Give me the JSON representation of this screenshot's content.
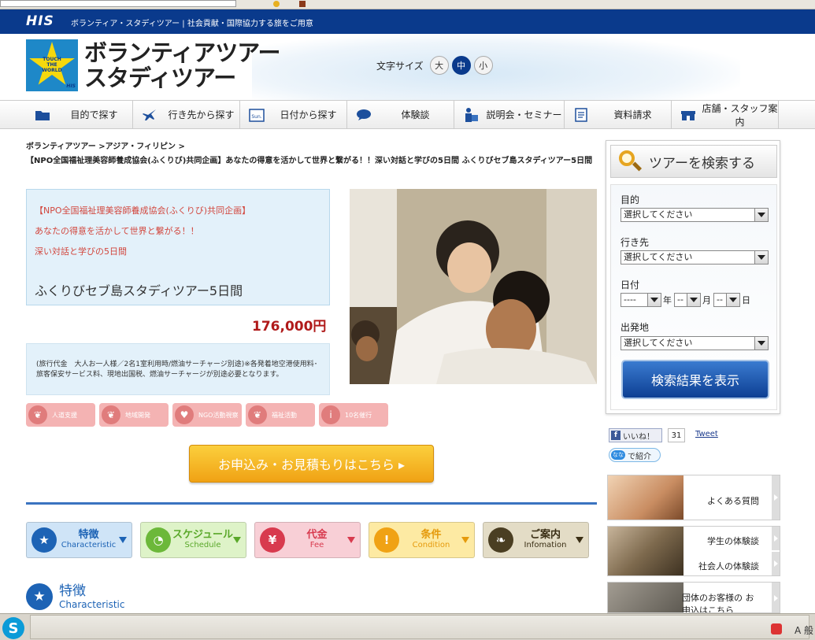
{
  "site": {
    "logo": "HIS",
    "tagline": "ボランティア・スタディツアー | 社会貢献・国際協力する旅をご用意",
    "brand_line1": "ボランティアツアー",
    "brand_line2": "スタディツアー",
    "logo_badge_lines": [
      "TOUCH",
      "THE",
      "WORLD"
    ],
    "logo_badge_sub": "HIS"
  },
  "font_size": {
    "label": "文字サイズ",
    "options": [
      "大",
      "中",
      "小"
    ],
    "selected": "中"
  },
  "nav": {
    "items": [
      {
        "label": "目的で探す",
        "icon": "folder-icon"
      },
      {
        "label": "行き先から探す",
        "icon": "airplane-icon"
      },
      {
        "label": "日付から探す",
        "icon": "calendar-icon",
        "icon_text": "Sun."
      },
      {
        "label": "体験談",
        "icon": "speech-bubble-icon"
      },
      {
        "label": "説明会・セミナー",
        "icon": "presenter-icon"
      },
      {
        "label": "資料請求",
        "icon": "document-icon"
      },
      {
        "label": "店舗・スタッフ案内",
        "icon": "shop-icon"
      }
    ]
  },
  "breadcrumb": {
    "path": "ボランティアツアー >アジア・フィリピン >",
    "current": "【NPO全国福祉理美容師養成協会(ふくりび)共同企画】あなたの得意を活かして世界と繋がる！！深い対話と学びの5日間 ふくりびセブ島スタディツアー5日間"
  },
  "tour": {
    "headline1": "【NPO全国福祉理美容師養成協会(ふくりび)共同企画】",
    "headline2": "あなたの得意を活かして世界と繋がる！！",
    "headline3": "深い対話と学びの5日間",
    "name": "ふくりびセブ島スタディツアー5日間",
    "price": "176,000円",
    "price_note": "(旅行代金　大人お一人様／2名1室利用時/燃油サーチャージ別途)※各発着地空港使用料･旅客保安サービス料、現地出国税、燃油サーチャージが別途必要となります。",
    "tags": [
      {
        "label": "人道支援",
        "icon": "leaf-icon"
      },
      {
        "label": "地域開発",
        "icon": "leaf-icon"
      },
      {
        "label": "NGO活動視察",
        "icon": "heart-icon"
      },
      {
        "label": "福祉活動",
        "icon": "leaf-icon"
      },
      {
        "label": "10名催行",
        "icon": "person-icon"
      }
    ],
    "apply_label": "お申込み・お見積もりはこちら ▸"
  },
  "section_tabs": [
    {
      "jp": "特徴",
      "en": "Characteristic",
      "icon": "star-icon",
      "bg": "#cfe4f7",
      "icon_bg": "#1d63b5",
      "color": "#1d63b5"
    },
    {
      "jp": "スケジュール",
      "en": "Schedule",
      "icon": "clock-icon",
      "bg": "#def3c8",
      "icon_bg": "#6cb83a",
      "color": "#5aa82a"
    },
    {
      "jp": "代金",
      "en": "Fee",
      "icon": "yen-icon",
      "bg": "#f8cfd6",
      "icon_bg": "#d83a4e",
      "color": "#d83a4e"
    },
    {
      "jp": "条件",
      "en": "Condition",
      "icon": "exclamation-icon",
      "bg": "#fdeaa3",
      "icon_bg": "#f0a214",
      "color": "#e59a0c"
    },
    {
      "jp": "ご案内",
      "en": "Infomation",
      "icon": "sprout-icon",
      "bg": "#e3dcc6",
      "icon_bg": "#4a3e22",
      "color": "#3a2e14"
    }
  ],
  "section_heading": {
    "jp": "特徴",
    "en": "Characteristic"
  },
  "search": {
    "title": "ツアーを検索する",
    "purpose_label": "目的",
    "purpose_value": "選択してください",
    "destination_label": "行き先",
    "destination_value": "選択してください",
    "date_label": "日付",
    "year_value": "----",
    "month_value": "--",
    "day_value": "--",
    "year_unit": "年",
    "month_unit": "月",
    "day_unit": "日",
    "departure_label": "出発地",
    "departure_value": "選択してください",
    "submit_label": "検索結果を表示"
  },
  "social": {
    "like_label": "いいね！",
    "like_count": "31",
    "tweet_label": "Tweet",
    "nana_badge": "なな",
    "nana_label": "で紹介"
  },
  "side_links": {
    "faq": "よくある質問",
    "student": "学生の体験談",
    "adult": "社会人の体験談",
    "group": "団体のお客様の お申込はこちら"
  },
  "taskbar": {
    "tray_text": "A 般"
  }
}
